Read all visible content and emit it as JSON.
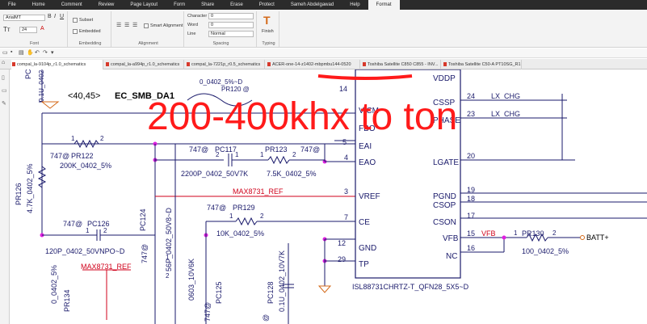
{
  "menu": [
    "File",
    "Home",
    "Comment",
    "Review",
    "Page Layout",
    "Form",
    "Share",
    "Erase",
    "Protect",
    "Sameh Abdelgawad",
    "Help",
    "Format"
  ],
  "ribbon": {
    "font_name": "ArialMT",
    "font_size": "24",
    "subset_label": "Subset",
    "embedded_label": "Embedded",
    "smart_alignment_label": "Smart Alignment",
    "character_label": "Character",
    "character_value": "0",
    "word_label": "Word",
    "word_value": "0",
    "line_label": "Line",
    "line_value": "Normal",
    "finish_label": "Finish",
    "group_font": "Font",
    "group_embedding": "Embedding",
    "group_alignment": "Alignment",
    "group_spacing": "Spacing",
    "group_typing": "Typing"
  },
  "tabs": [
    "compal_la-9104p_r1.0_schematics",
    "compal_la-a994p_r1.0_schematics",
    "compal_la-7221p_r0.5_schematics",
    "ACER-one-14-z1402-mbpmbu144-0520",
    "Toshiba Satellite C850 C855 - INV...",
    "Toshiba Satellite C50-A PT10SG_R1..."
  ],
  "annotation": "200-400khx to ton",
  "schematic": {
    "net_ec_smb": "<40,45>",
    "net_ec_smb_name": "EC_SMB_DA1",
    "chip_name": "ISL88731CHRTZ-T_QFN28_5X5~D",
    "left_pins": [
      {
        "num": "14",
        "name": ""
      },
      {
        "num": "",
        "name": "VICM"
      },
      {
        "num": "",
        "name": "FBO"
      },
      {
        "num": "5",
        "name": "EAI"
      },
      {
        "num": "4",
        "name": "EAO"
      },
      {
        "num": "3",
        "name": "VREF"
      },
      {
        "num": "7",
        "name": "CE"
      },
      {
        "num": "12",
        "name": "GND"
      },
      {
        "num": "29",
        "name": "TP"
      }
    ],
    "right_pins": [
      {
        "num": "",
        "name": "VDDP"
      },
      {
        "num": "24",
        "name": "CSSP"
      },
      {
        "num": "23",
        "name": "PHASE"
      },
      {
        "num": "20",
        "name": "LGATE"
      },
      {
        "num": "19",
        "name": "PGND"
      },
      {
        "num": "18",
        "name": "CSOP"
      },
      {
        "num": "17",
        "name": "CSON"
      },
      {
        "num": "15",
        "name": "VFB"
      },
      {
        "num": "16",
        "name": "NC"
      }
    ],
    "right_nets": [
      "LX_CHG",
      "LX_CHG"
    ],
    "vfb_net": "VFB",
    "batt_net": "BATT+",
    "max_ref": "MAX8731_REF",
    "pr120": "PR120 @",
    "pr120_val": "0_0402_5%~D",
    "pr122": "PR122",
    "pr122_pop": "747@",
    "pr122_val": "200K_0402_5%",
    "pr126": "PR126",
    "pr126_val": "4.7K_0402_5%",
    "pc117": "PC117",
    "pc117_pop": "747@",
    "pc117_val": "2200P_0402_50V7K",
    "pr123": "PR123",
    "pr123_pop": "747@",
    "pr123_val": "7.5K_0402_5%",
    "pr129": "PR129",
    "pr129_pop": "747@",
    "pr129_val": "10K_0402_5%",
    "pc126": "PC126",
    "pc126_pop": "747@",
    "pc126_val": "120P_0402_50VNPO~D",
    "pc124": "PC124",
    "pc124_pop": "747@",
    "pc124_val": "56P_0402_50V8~D",
    "pc125": "PC125",
    "pc125_pop": "747@",
    "pc125_val": "0603_10V6K",
    "pc128": "PC128",
    "pc128_pop": "@",
    "pc128_val": "0.1U_0402_10V7K",
    "pr134": "PR134",
    "pr134_val": "0_0402_5%",
    "pr130": "PR130",
    "pr130_val": "100_0402_5%",
    "top_cap_val": "0.1U_0402",
    "top_cap_label": "PC"
  }
}
